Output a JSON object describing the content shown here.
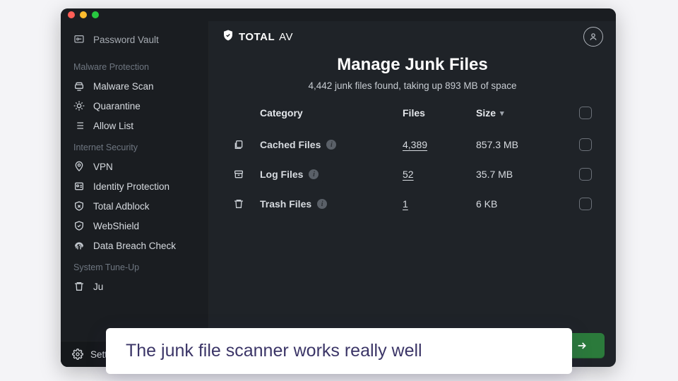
{
  "brand": {
    "bold": "TOTAL",
    "thin": "AV"
  },
  "sidebar": {
    "top_label": "Password Vault",
    "sections": [
      {
        "title": "Malware Protection",
        "items": [
          {
            "label": "Malware Scan"
          },
          {
            "label": "Quarantine"
          },
          {
            "label": "Allow List"
          }
        ]
      },
      {
        "title": "Internet Security",
        "items": [
          {
            "label": "VPN"
          },
          {
            "label": "Identity Protection"
          },
          {
            "label": "Total Adblock"
          },
          {
            "label": "WebShield"
          },
          {
            "label": "Data Breach Check"
          }
        ]
      },
      {
        "title": "System Tune-Up",
        "items": [
          {
            "label": "Ju"
          }
        ]
      }
    ],
    "footer_label": "Sett"
  },
  "page": {
    "title": "Manage Junk Files",
    "subtitle": "4,442 junk files found, taking up 893 MB of space"
  },
  "table": {
    "headers": {
      "category": "Category",
      "files": "Files",
      "size": "Size"
    },
    "rows": [
      {
        "category": "Cached Files",
        "files": "4,389",
        "size": "857.3 MB"
      },
      {
        "category": "Log Files",
        "files": "52",
        "size": "35.7 MB"
      },
      {
        "category": "Trash Files",
        "files": "1",
        "size": "6 KB"
      }
    ]
  },
  "caption": "The junk file scanner works really well"
}
